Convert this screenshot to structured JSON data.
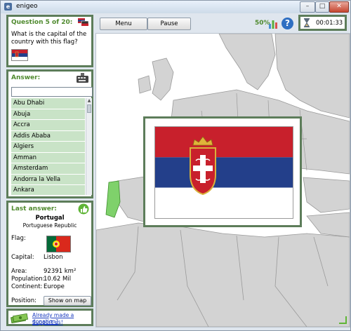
{
  "window": {
    "title": "enigeo"
  },
  "question": {
    "header": "Question 5 of 20:",
    "text_line1": "What is the capital of the",
    "text_line2": "country with this flag?"
  },
  "toolbar": {
    "menu_label": "Menu",
    "pause_label": "Pause",
    "progress": "50%",
    "timer": "00:01:33"
  },
  "answer": {
    "header": "Answer:",
    "search_value": "",
    "items": [
      "Abu Dhabi",
      "Abuja",
      "Accra",
      "Addis Ababa",
      "Algiers",
      "Amman",
      "Amsterdam",
      "Andorra la Vella",
      "Ankara"
    ]
  },
  "last_answer": {
    "header": "Last answer:",
    "country": "Portugal",
    "official_name": "Portuguese Republic",
    "flag_label": "Flag:",
    "capital_label": "Capital:",
    "capital": "Lisbon",
    "area_label": "Area:",
    "area": "92391 km²",
    "population_label": "Population:",
    "population": "10.62 Mil",
    "continent_label": "Continent:",
    "continent": "Europe",
    "position_label": "Position:",
    "show_on_map_label": "Show on map"
  },
  "donation": {
    "line1": "Already made a donation?",
    "line2": "Support us!"
  },
  "colors": {
    "panel_border": "#5d7d5a",
    "accent_green": "#4f8a2e",
    "list_bg": "#c9e3c7",
    "serbia_red": "#c8202c",
    "serbia_blue": "#233f8a"
  }
}
